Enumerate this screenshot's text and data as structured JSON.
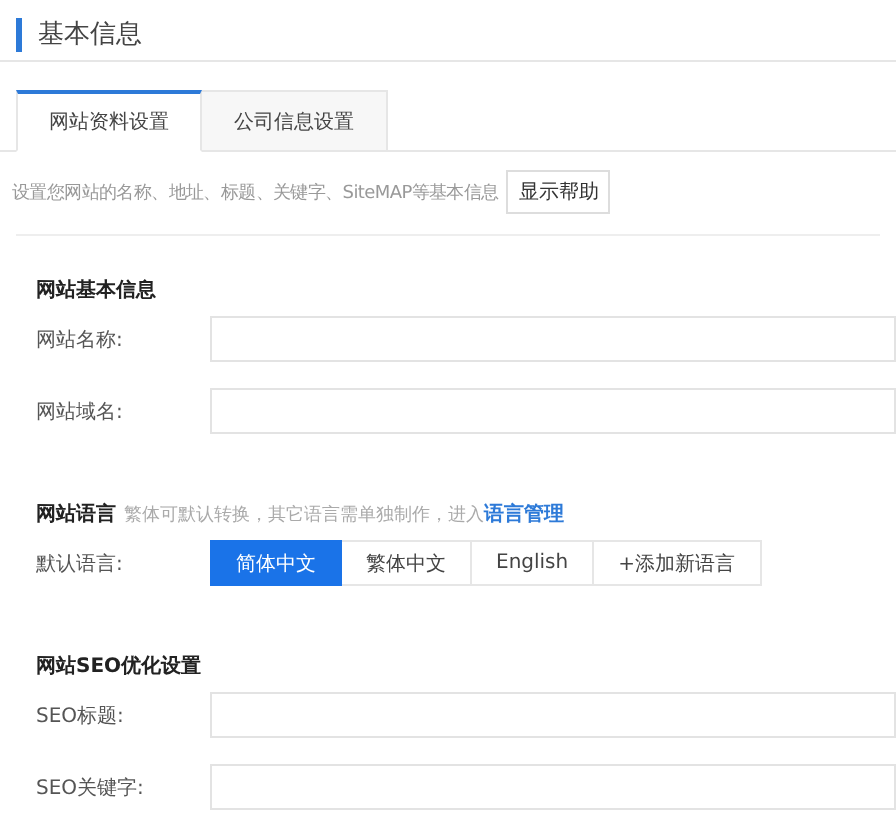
{
  "header": {
    "title": "基本信息"
  },
  "tabs": [
    {
      "label": "网站资料设置",
      "selected": true
    },
    {
      "label": "公司信息设置",
      "selected": false
    }
  ],
  "description": {
    "text": "设置您网站的名称、地址、标题、关键字、SiteMAP等基本信息",
    "help_button": "显示帮助"
  },
  "sections": [
    {
      "title": "网站基本信息",
      "fields": [
        {
          "label": "网站名称:"
        },
        {
          "label": "网站域名:"
        }
      ]
    },
    {
      "title": "网站语言",
      "note": "繁体可默认转换，其它语言需单独制作，进入",
      "link": "语言管理",
      "default_label": "默认语言:",
      "languages": [
        {
          "label": "简体中文",
          "selected": true
        },
        {
          "label": "繁体中文",
          "selected": false
        },
        {
          "label": "English",
          "selected": false
        }
      ],
      "add_button": "+添加新语言"
    },
    {
      "title": "网站SEO优化设置",
      "fields": [
        {
          "label": "SEO标题:"
        },
        {
          "label": "SEO关键字:"
        }
      ]
    }
  ]
}
